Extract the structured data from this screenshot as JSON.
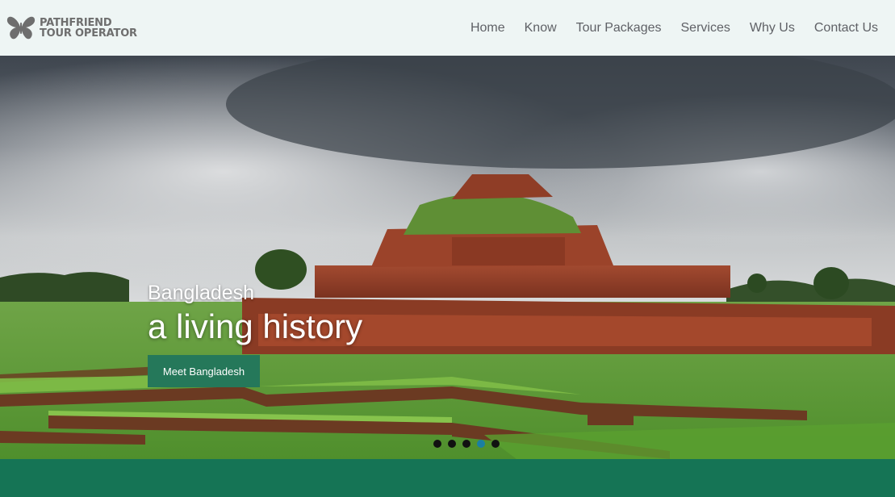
{
  "brand": {
    "line1": "PATHFRIEND",
    "line2": "TOUR OPERATOR",
    "icon": "butterfly-logo-icon",
    "color": "#6e6e6e"
  },
  "nav": {
    "items": [
      {
        "label": "Home"
      },
      {
        "label": "Know"
      },
      {
        "label": "Tour Packages"
      },
      {
        "label": "Services"
      },
      {
        "label": "Why Us"
      },
      {
        "label": "Contact Us"
      }
    ]
  },
  "hero": {
    "subtitle": "Bangladesh",
    "title": "a living history",
    "button_label": "Meet Bangladesh",
    "button_color": "#25785a",
    "slides_count": 5,
    "active_slide": 4
  },
  "colors": {
    "header_bg": "#eef5f4",
    "band": "#157455",
    "active_dot": "#1a7fa3"
  }
}
